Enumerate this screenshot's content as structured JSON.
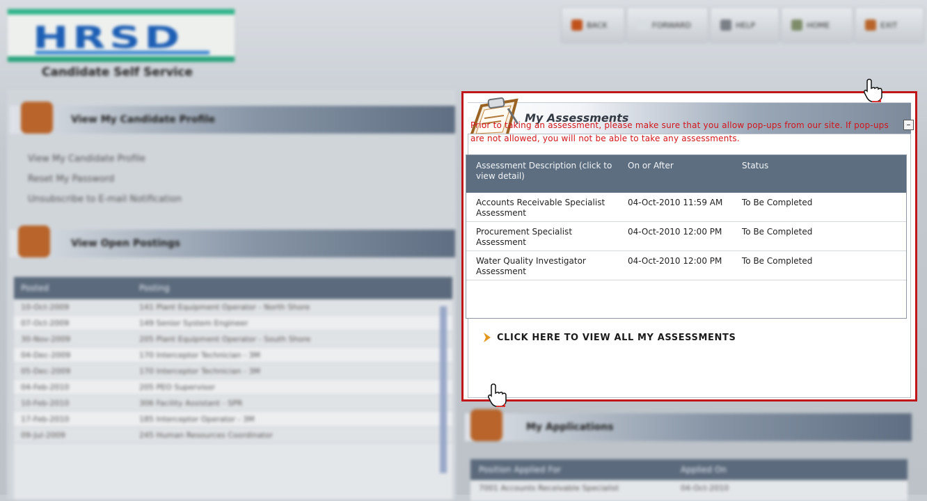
{
  "header": {
    "logo_text": "HRSD",
    "app_title": "Candidate Self Service",
    "toolbar": [
      {
        "label": "BACK",
        "icon": "back-arrow-icon"
      },
      {
        "label": "FORWARD",
        "icon": "forward-arrow-icon"
      },
      {
        "label": "HELP",
        "icon": "help-icon"
      },
      {
        "label": "HOME",
        "icon": "home-icon"
      },
      {
        "label": "EXIT",
        "icon": "exit-icon"
      }
    ]
  },
  "left": {
    "profile_section_title": "View My Candidate Profile",
    "profile_links": [
      "View My Candidate Profile",
      "Reset My Password",
      "Unsubscribe to E-mail Notification"
    ],
    "postings_section_title": "View Open Postings",
    "postings_columns": [
      "Posted",
      "Posting"
    ],
    "postings_rows": [
      [
        "10-Oct-2009",
        "141 Plant Equipment Operator - North Shore"
      ],
      [
        "07-Oct-2009",
        "149 Senior System Engineer"
      ],
      [
        "30-Nov-2009",
        "205 Plant Equipment Operator - South Shore"
      ],
      [
        "04-Dec-2009",
        "170 Interceptor Technician - 3M"
      ],
      [
        "05-Dec-2009",
        "170 Interceptor Technician - 3M"
      ],
      [
        "04-Feb-2010",
        "205 PEO Supervisor"
      ],
      [
        "10-Feb-2010",
        "306 Facility Assistant - SPR"
      ],
      [
        "17-Feb-2010",
        "185 Interceptor Operator - 3M"
      ],
      [
        "09-Jul-2009",
        "245 Human Resources Coordinator"
      ]
    ]
  },
  "assessments": {
    "title": "My Assessments",
    "collapse_label": "–",
    "warning": "Prior to taking an assessment, please make sure that you allow pop-ups from our site. If pop-ups are not allowed, you will not be able to take any assessments.",
    "columns": [
      "Assessment Description (click to view detail)",
      "On or After",
      "Status"
    ],
    "rows": [
      {
        "description": "Accounts Receivable Specialist Assessment",
        "date": "04-Oct-2010 11:59 AM",
        "status": "To Be Completed"
      },
      {
        "description": "Procurement Specialist Assessment",
        "date": "04-Oct-2010 12:00 PM",
        "status": "To Be Completed"
      },
      {
        "description": "Water Quality Investigator Assessment",
        "date": "04-Oct-2010 12:00 PM",
        "status": "To Be Completed"
      }
    ],
    "view_all_label": "CLICK HERE TO VIEW ALL MY ASSESSMENTS"
  },
  "applications": {
    "title": "My Applications",
    "columns": [
      "Position Applied For",
      "Applied On"
    ],
    "first_row": [
      "7001 Accounts Receivable Specialist",
      "04-Oct-2010"
    ]
  },
  "colors": {
    "highlight_border": "#c0161a",
    "warning_text": "#d3141b",
    "table_header": "#5d6e80"
  }
}
